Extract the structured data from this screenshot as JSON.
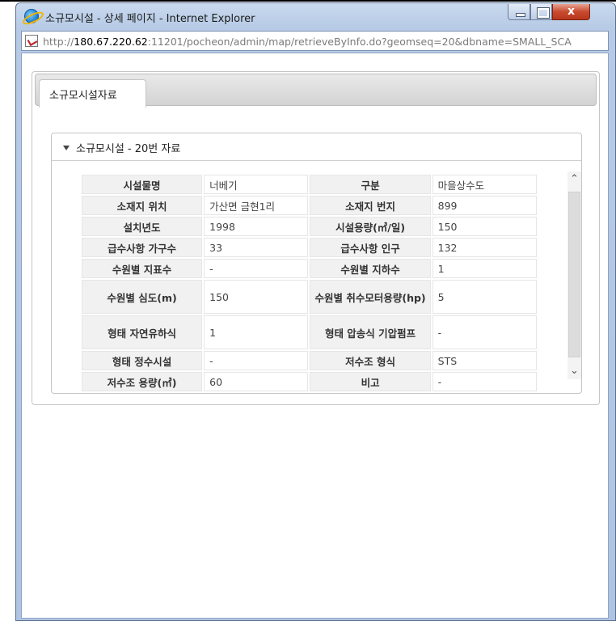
{
  "window": {
    "title": "소규모시설 - 상세 페이지 - Internet Explorer",
    "close_label": "x"
  },
  "address": {
    "url_prefix": "http://",
    "url_host": "180.67.220.62",
    "url_rest": ":11201/pocheon/admin/map/retrieveByInfo.do?geomseq=20&dbname=SMALL_SCA"
  },
  "tab": {
    "label": "소규모시설자료"
  },
  "section": {
    "title": "소규모시설 - 20번 자료"
  },
  "table": {
    "rows": [
      {
        "k1": "시설물명",
        "v1": "너베기",
        "k2": "구분",
        "v2": "마을상수도"
      },
      {
        "k1": "소재지 위치",
        "v1": "가산면 금현1리",
        "k2": "소재지 번지",
        "v2": "899"
      },
      {
        "k1": "설치년도",
        "v1": "1998",
        "k2": "시설용량(㎥/일)",
        "v2": "150"
      },
      {
        "k1": "급수사항 가구수",
        "v1": "33",
        "k2": "급수사항 인구",
        "v2": "132"
      },
      {
        "k1": "수원별 지표수",
        "v1": "-",
        "k2": "수원별 지하수",
        "v2": "1"
      },
      {
        "k1": "수원별 심도(m)",
        "v1": "150",
        "k2": "수원별 취수모터용량(hp)",
        "v2": "5"
      },
      {
        "k1": "형태 자연유하식",
        "v1": "1",
        "k2": "형태 압송식 기압펌프",
        "v2": "-"
      },
      {
        "k1": "형태 정수시설",
        "v1": "-",
        "k2": "저수조 형식",
        "v2": "STS"
      },
      {
        "k1": "저수조 용량(㎥)",
        "v1": "60",
        "k2": "비고",
        "v2": "-"
      }
    ]
  },
  "scrollbar": {
    "up_glyph": "⌃",
    "down_glyph": "⌄"
  }
}
